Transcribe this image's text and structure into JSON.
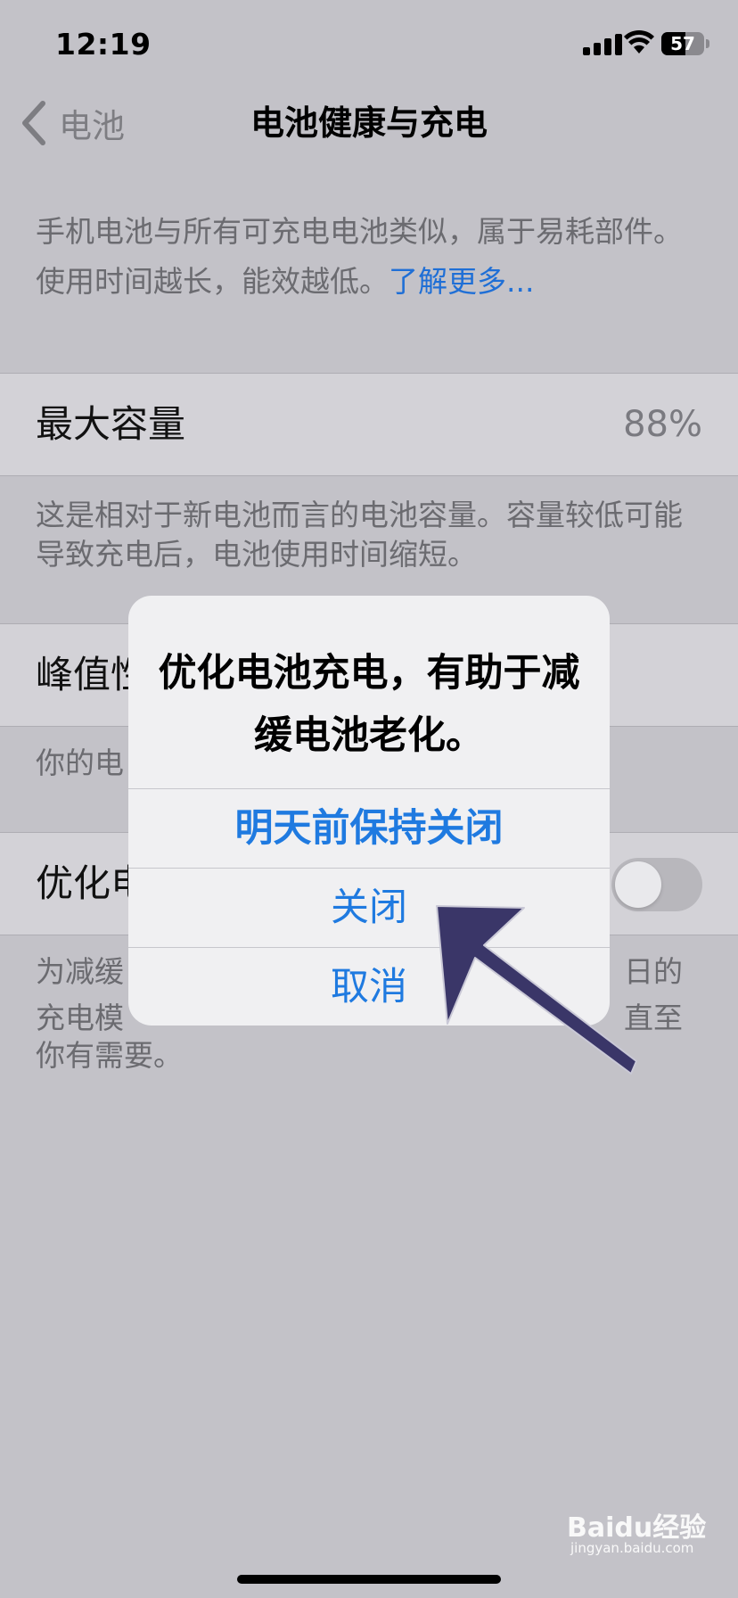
{
  "status_bar": {
    "time": "12:19",
    "battery_level": "57",
    "battery_fraction": 0.57
  },
  "nav": {
    "back_label": "电池",
    "title": "电池健康与充电"
  },
  "intro": {
    "text": "手机电池与所有可充电电池类似，属于易耗部件。使用时间越长，能效越低。",
    "link": "了解更多..."
  },
  "max_capacity": {
    "label": "最大容量",
    "value": "88%",
    "footer": "这是相对于新电池而言的电池容量。容量较低可能导致充电后，电池使用时间缩短。"
  },
  "peak_performance": {
    "label": "峰值性",
    "footer": "你的电"
  },
  "optimized_charging": {
    "label": "优化电",
    "toggle_on": false,
    "footer_line1_left": "为减缓",
    "footer_line1_right": "日的",
    "footer_line2_left": "充电模",
    "footer_line2_right": "直至",
    "footer_line3": "你有需要。"
  },
  "alert": {
    "title": "优化电池充电，有助于减缓电池老化。",
    "buttons": [
      "明天前保持关闭",
      "关闭",
      "取消"
    ]
  },
  "watermark": {
    "brand": "Baidu经验",
    "url": "jingyan.baidu.com"
  },
  "colors": {
    "accent": "#1f7ae0",
    "annotation_arrow": "#3a3668"
  }
}
